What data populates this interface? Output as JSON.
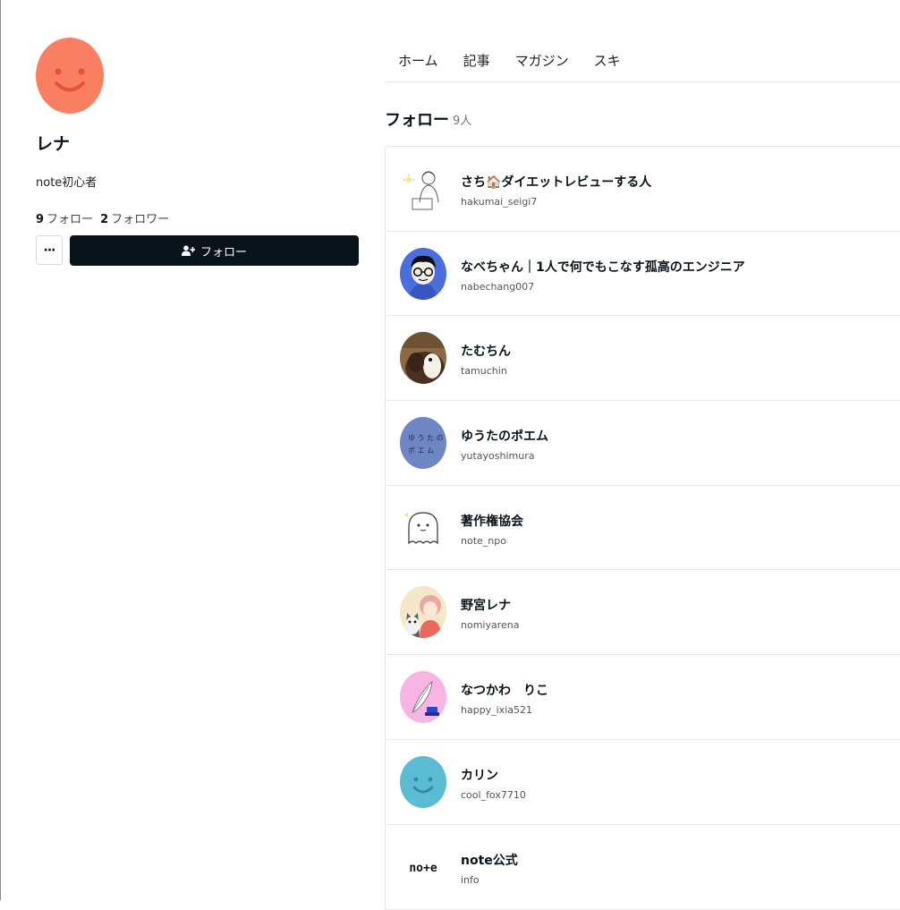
{
  "profile": {
    "name": "レナ",
    "bio": "note初心者",
    "following_count": "9",
    "following_label": "フォロー",
    "followers_count": "2",
    "followers_label": "フォロワー",
    "more_label": "···",
    "follow_button_label": "フォロー",
    "avatar_color": "#fa7f62"
  },
  "tabs": [
    {
      "label": "ホーム"
    },
    {
      "label": "記事"
    },
    {
      "label": "マガジン"
    },
    {
      "label": "スキ"
    }
  ],
  "section": {
    "title": "フォロー",
    "count": "9人"
  },
  "follows": [
    {
      "name": "さち🏠ダイエットレビューする人",
      "id": "hakumai_seigi7",
      "avatar": "sketch-person-avatar"
    },
    {
      "name": "なべちゃん｜1人で何でもこなす孤高のエンジニア",
      "id": "nabechang007",
      "avatar": "glasses-man-avatar"
    },
    {
      "name": "たむちん",
      "id": "tamuchin",
      "avatar": "dog-photo-avatar"
    },
    {
      "name": "ゆうたのポエム",
      "id": "yutayoshimura",
      "avatar": "poem-text-avatar"
    },
    {
      "name": "著作権協会",
      "id": "note_npo",
      "avatar": "ghost-avatar"
    },
    {
      "name": "野宮レナ",
      "id": "nomiyarena",
      "avatar": "girl-with-dog-avatar"
    },
    {
      "name": "なつかわ　りこ",
      "id": "happy_ixia521",
      "avatar": "feather-pen-avatar"
    },
    {
      "name": "カリン",
      "id": "cool_fox7710",
      "avatar": "smiley-avatar"
    },
    {
      "name": "note公式",
      "id": "info",
      "avatar": "note-logo-avatar",
      "logo_text": "no+e"
    }
  ],
  "colors": {
    "primary_dark": "#08131a",
    "border": "#e5e7e8",
    "karin_avatar": "#5bbbd2",
    "poem_avatar": "#6f86c4",
    "pen_avatar": "#f9b4e6"
  }
}
